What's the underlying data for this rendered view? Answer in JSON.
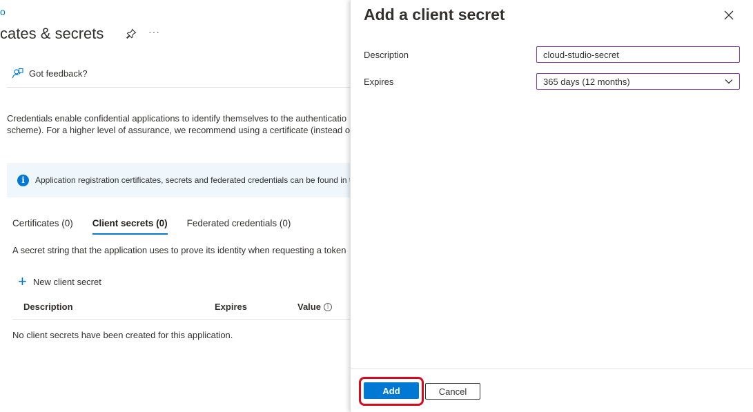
{
  "background_page": {
    "breadcrumb_fragment": "o",
    "title": "cates & secrets",
    "more_label": "···",
    "feedback_label": "Got feedback?",
    "description_line1": "Credentials enable confidential applications to identify themselves to the authenticatio",
    "description_line2": "scheme). For a higher level of assurance, we recommend using a certificate (instead of",
    "info_message": "Application registration certificates, secrets and federated credentials can be found in t",
    "tabs": [
      {
        "label": "Certificates (0)"
      },
      {
        "label": "Client secrets (0)"
      },
      {
        "label": "Federated credentials (0)"
      }
    ],
    "secret_description": "A secret string that the application uses to prove its identity when requesting a token",
    "new_secret_label": "New client secret",
    "table_headers": {
      "description": "Description",
      "expires": "Expires",
      "value": "Value"
    },
    "empty_message": "No client secrets have been created for this application."
  },
  "panel": {
    "title": "Add a client secret",
    "description_label": "Description",
    "description_value": "cloud-studio-secret",
    "expires_label": "Expires",
    "expires_value": "365 days (12 months)",
    "add_label": "Add",
    "cancel_label": "Cancel"
  },
  "colors": {
    "accent": "#0078d4",
    "highlight": "#d40b1c",
    "input_border": "#8a3ea1"
  }
}
